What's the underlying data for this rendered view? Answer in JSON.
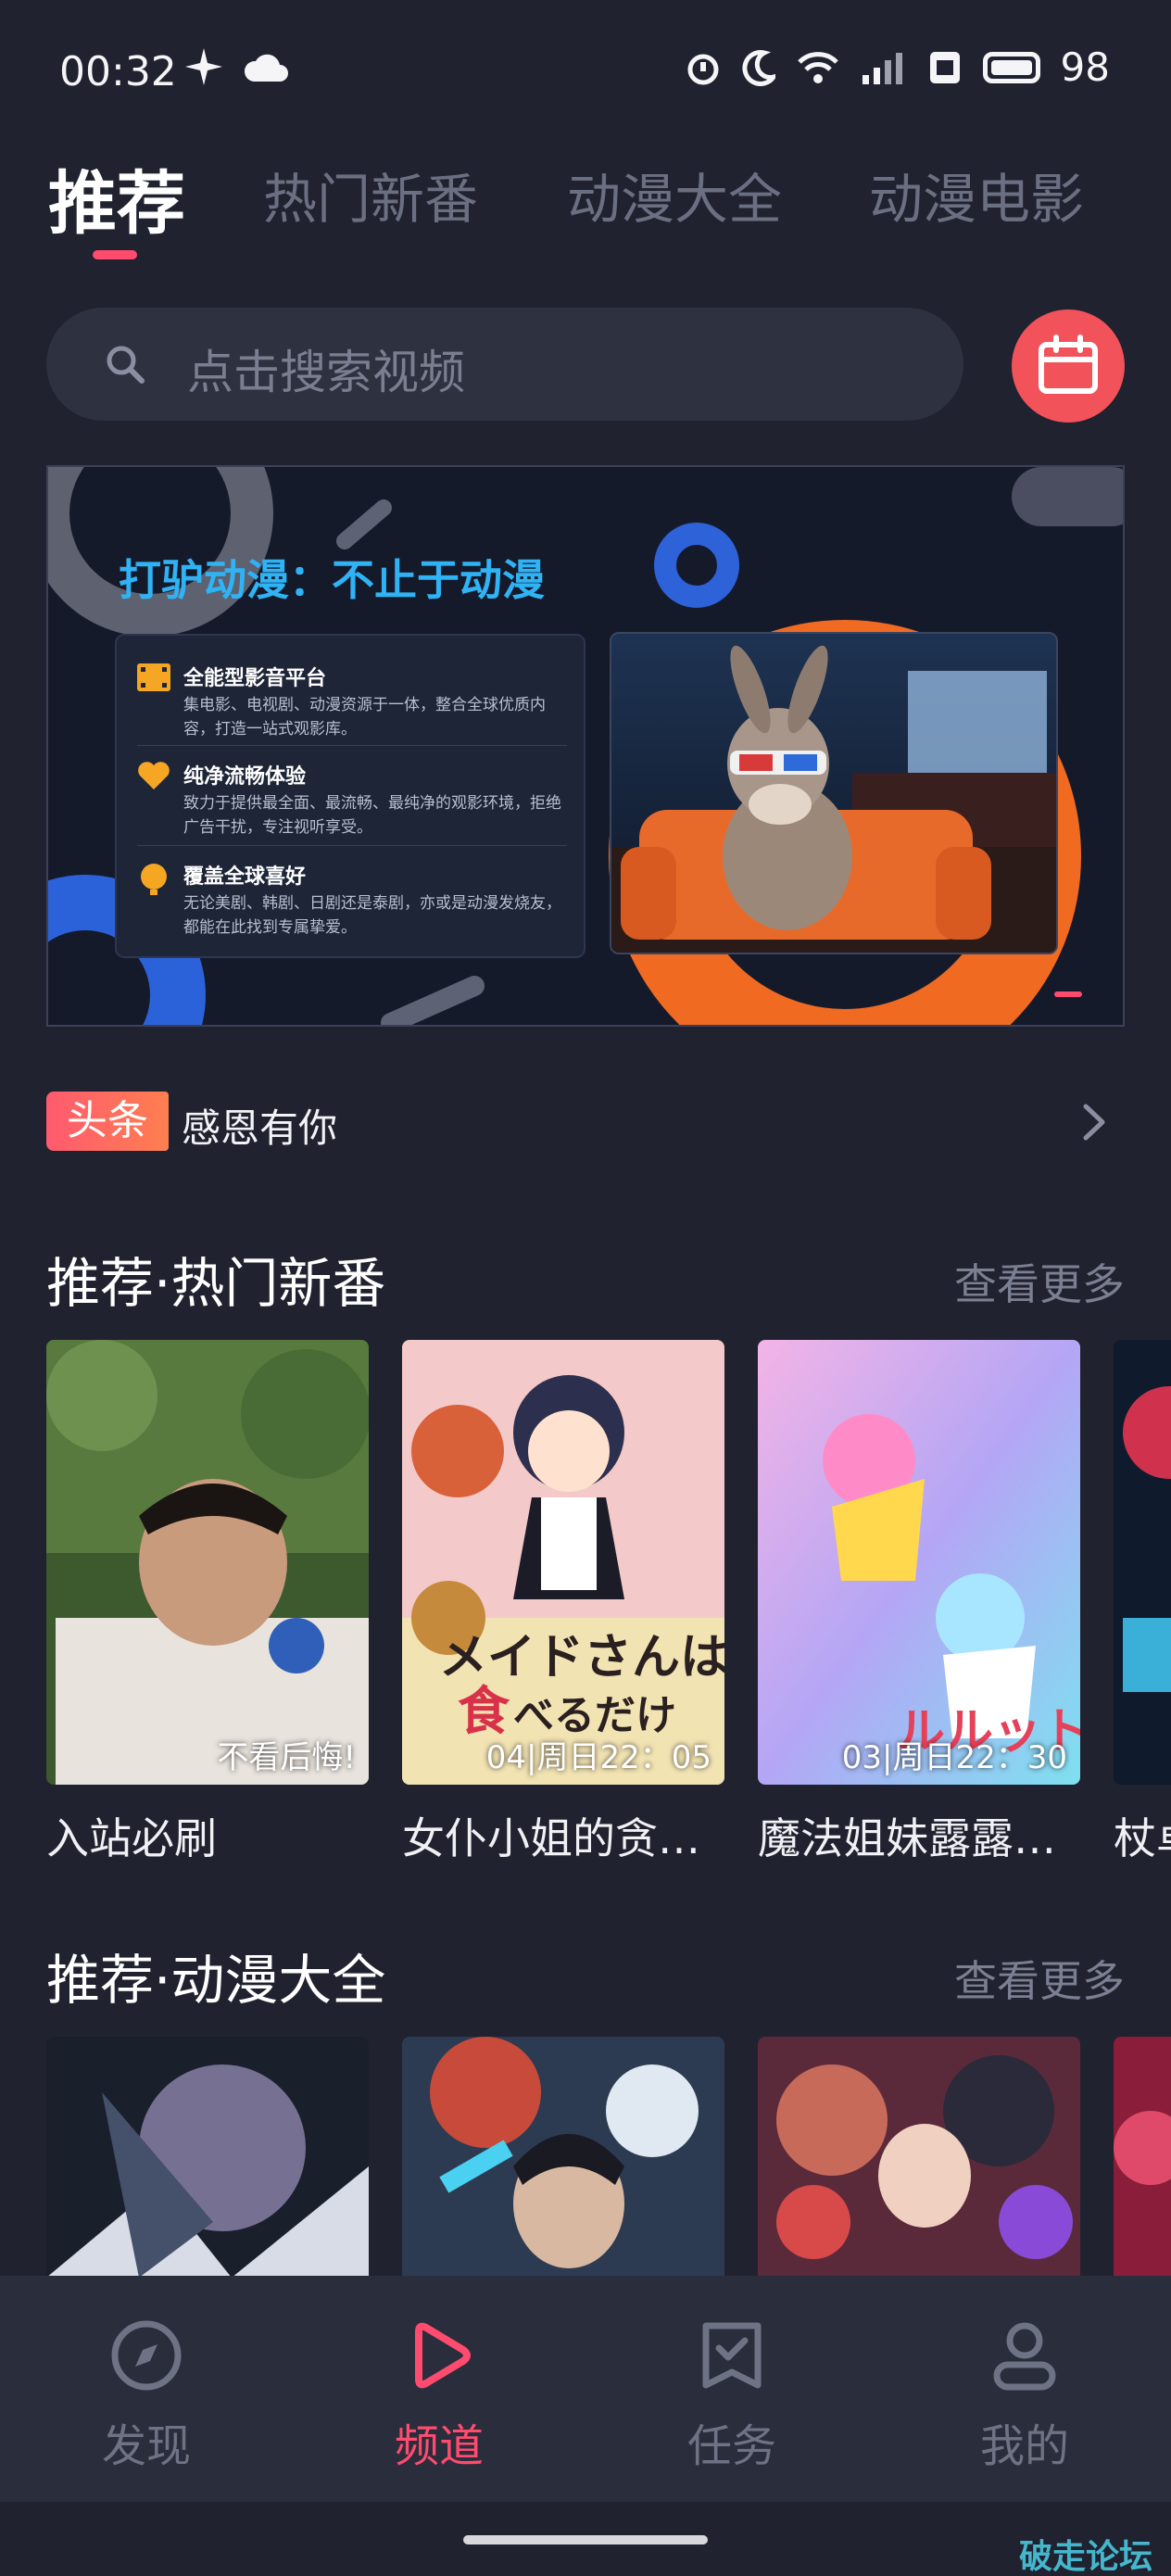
{
  "status_bar": {
    "time": "00:32",
    "battery": "98"
  },
  "tabs": [
    {
      "label": "推荐",
      "active": true
    },
    {
      "label": "热门新番",
      "active": false
    },
    {
      "label": "动漫大全",
      "active": false
    },
    {
      "label": "动漫电影",
      "active": false
    }
  ],
  "search": {
    "placeholder": "点击搜索视频"
  },
  "banner": {
    "title": "打驴动漫：不止于动漫",
    "features": [
      {
        "title": "全能型影音平台",
        "desc": "集电影、电视剧、动漫资源于一体，整合全球优质内容，打造一站式观影库。",
        "icon": "film-icon"
      },
      {
        "title": "纯净流畅体验",
        "desc": "致力于提供最全面、最流畅、最纯净的观影环境，拒绝广告干扰，专注视听享受。",
        "icon": "heart-icon"
      },
      {
        "title": "覆盖全球喜好",
        "desc": "无论美剧、韩剧、日剧还是泰剧，亦或是动漫发烧友，都能在此找到专属挚爱。",
        "icon": "globe-icon"
      }
    ]
  },
  "headline": {
    "badge": "头条",
    "text": "感恩有你"
  },
  "section_new": {
    "title": "推荐·热门新番",
    "more": "查看更多",
    "items": [
      {
        "title": "入站必刷",
        "tag": "不看后悔!"
      },
      {
        "title": "女仆小姐的贪…",
        "tag": "04|周日22：05"
      },
      {
        "title": "魔法姐妹露露…",
        "tag": "03|周日22：30"
      },
      {
        "title": "杖卓",
        "tag": ""
      }
    ]
  },
  "section_all": {
    "title": "推荐·动漫大全",
    "more": "查看更多"
  },
  "bottom_nav": [
    {
      "label": "发现",
      "icon": "compass-icon",
      "active": false
    },
    {
      "label": "频道",
      "icon": "play-icon",
      "active": true
    },
    {
      "label": "任务",
      "icon": "task-icon",
      "active": false
    },
    {
      "label": "我的",
      "icon": "user-icon",
      "active": false
    }
  ],
  "watermark": "破走论坛",
  "colors": {
    "background": "#20222f",
    "accent": "#ff4b6e",
    "calendar_button": "#f2525a"
  }
}
